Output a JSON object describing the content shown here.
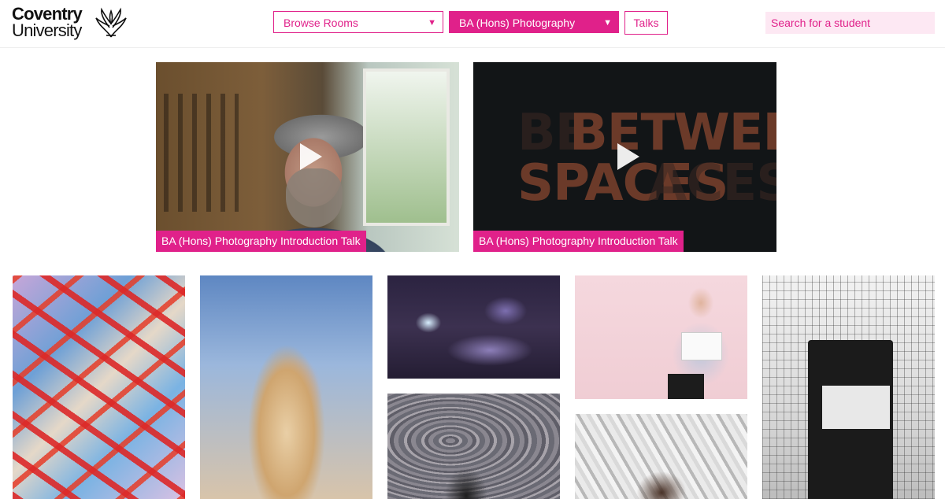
{
  "header": {
    "logo": {
      "line1": "Coventry",
      "line2": "University"
    },
    "rooms_dropdown": {
      "label": "Browse Rooms"
    },
    "course_dropdown": {
      "label": "BA (Hons) Photography"
    },
    "talks_button": {
      "label": "Talks"
    },
    "search": {
      "placeholder": "Search for a student"
    },
    "accent_color": "#e0218a"
  },
  "videos": [
    {
      "caption": "BA (Hons) Photography Introduction Talk"
    },
    {
      "caption": "BA (Hons) Photography Introduction Talk",
      "title_word_1": "BETWEEN",
      "title_word_2": "SPACES",
      "ghost_text_1": "BE",
      "ghost_text_2": "ACES"
    }
  ],
  "gallery": [
    {
      "subject": "collage-with-red-tape"
    },
    {
      "subject": "windswept-blonde-hair"
    },
    {
      "subject": "dark-bedroom-interior"
    },
    {
      "subject": "man-holding-photo-on-pink"
    },
    {
      "subject": "black-bin-behind-fence"
    },
    {
      "subject": "marbled-surface-silhouette"
    },
    {
      "subject": "foil-backdrop-portrait"
    }
  ]
}
